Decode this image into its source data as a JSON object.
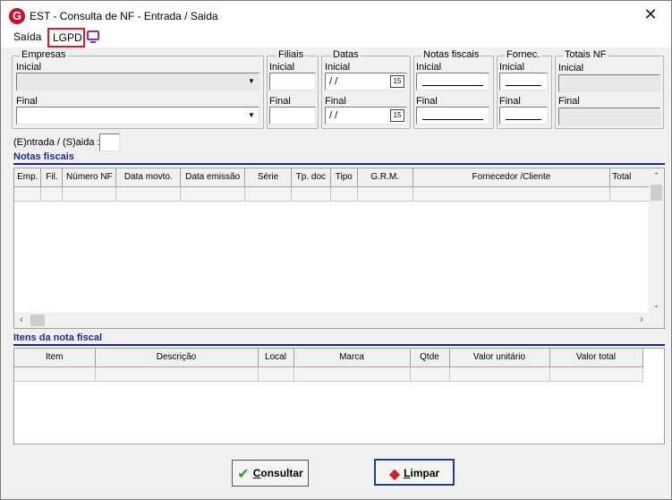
{
  "window": {
    "title": "EST - Consulta de NF - Entrada / Saida",
    "app_icon_letter": "G",
    "close_glyph": "✕"
  },
  "menu": {
    "items": [
      {
        "label": "Saída"
      },
      {
        "label": "LGPD"
      }
    ],
    "screen_icon": "monitor-icon"
  },
  "filters": {
    "empresas": {
      "title": "Empresas",
      "inicial_label": "Inicial",
      "final_label": "Final",
      "inicial_value": "",
      "final_value": ""
    },
    "filiais": {
      "title": "Filiais",
      "inicial_label": "Inicial",
      "final_label": "Final"
    },
    "datas": {
      "title": "Datas",
      "inicial_label": "Inicial",
      "final_label": "Final",
      "inicial_value": " /  /",
      "final_value": " /  /",
      "calendar_glyph": "15"
    },
    "notas": {
      "title": "Notas fiscais",
      "inicial_label": "Inicial",
      "final_label": "Final"
    },
    "fornec": {
      "title": "Fornec.",
      "inicial_label": "Inicial",
      "final_label": "Final"
    },
    "totais": {
      "title": "Totais NF",
      "inicial_label": "Inicial",
      "final_label": "Final"
    },
    "entrada_saida_label": "(E)ntrada / (S)aida :"
  },
  "notas_grid": {
    "section_title": "Notas fiscais",
    "columns": [
      "Emp.",
      "Fil.",
      "Número NF",
      "Data movto.",
      "Data emissão",
      "Série",
      "Tp. doc",
      "Tipo",
      "G.R.M.",
      "Fornecedor /Cliente",
      "Total"
    ]
  },
  "itens_grid": {
    "section_title": "Itens da nota fiscal",
    "columns": [
      "Item",
      "Descrição",
      "Local",
      "Marca",
      "Qtde",
      "Valor unitário",
      "Valor total"
    ]
  },
  "buttons": {
    "consultar": {
      "underline": "C",
      "rest": "onsultar"
    },
    "limpar": {
      "underline": "L",
      "rest": "impar"
    }
  },
  "colors": {
    "section_title": "#1b2a8a",
    "lgpd_highlight": "#e01b24",
    "screen_icon": "#8e2dc5",
    "app_icon": "#c8102e"
  }
}
